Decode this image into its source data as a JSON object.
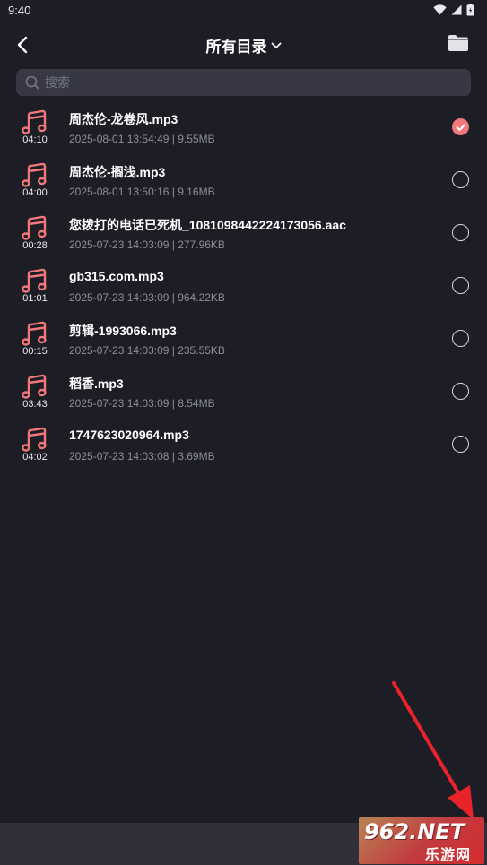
{
  "status_bar": {
    "time": "9:40"
  },
  "header": {
    "back_icon": "chevron-left-icon",
    "title": "所有目录",
    "dropdown_icon": "chevron-down-icon",
    "folder_icon": "folder-icon"
  },
  "search": {
    "placeholder": "搜索",
    "value": ""
  },
  "files": [
    {
      "name": "周杰伦-龙卷风.mp3",
      "meta": "2025-08-01 13:54:49 | 9.55MB",
      "duration": "04:10",
      "checked": true
    },
    {
      "name": "周杰伦-搁浅.mp3",
      "meta": "2025-08-01 13:50:16 | 9.16MB",
      "duration": "04:00",
      "checked": false
    },
    {
      "name": "您拨打的电话已死机_1081098442224173056.aac",
      "meta": "2025-07-23 14:03:09 | 277.96KB",
      "duration": "00:28",
      "checked": false
    },
    {
      "name": "gb315.com.mp3",
      "meta": "2025-07-23 14:03:09 | 964.22KB",
      "duration": "01:01",
      "checked": false
    },
    {
      "name": "剪辑-1993066.mp3",
      "meta": "2025-07-23 14:03:09 | 235.55KB",
      "duration": "00:15",
      "checked": false
    },
    {
      "name": "稻香.mp3",
      "meta": "2025-07-23 14:03:09 | 8.54MB",
      "duration": "03:43",
      "checked": false
    },
    {
      "name": "1747623020964.mp3",
      "meta": "2025-07-23 14:03:08 | 3.69MB",
      "duration": "04:02",
      "checked": false
    }
  ],
  "watermark": {
    "top": "962.NET",
    "bottom": "乐游网"
  },
  "colors": {
    "background": "#1d1d26",
    "accent": "#f27879",
    "search_bg": "#373844",
    "bottom_bar": "#2f303a",
    "annotation_arrow": "#e8242a"
  }
}
